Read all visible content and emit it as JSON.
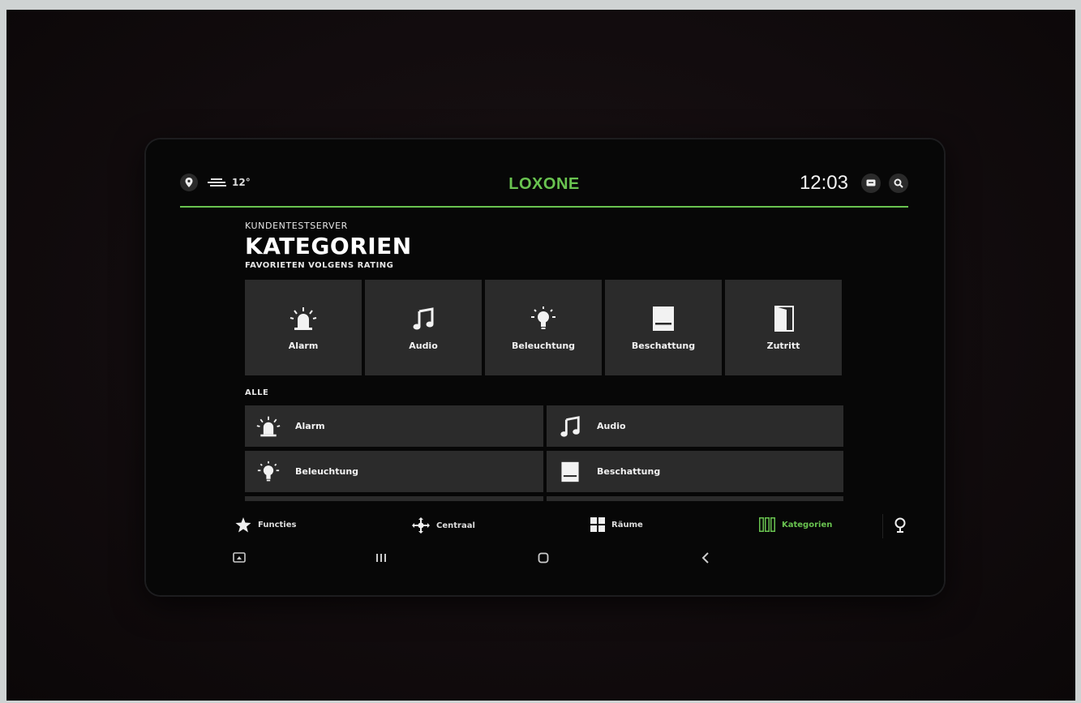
{
  "header": {
    "temperature": "12°",
    "brand": "LOXONE",
    "time": "12:03"
  },
  "page": {
    "server_name": "KUNDENTESTSERVER",
    "title": "KATEGORIEN",
    "favorites_label": "FAVORIETEN VOLGENS RATING",
    "all_label": "ALLE"
  },
  "favorites": [
    {
      "label": "Alarm",
      "icon": "siren-icon"
    },
    {
      "label": "Audio",
      "icon": "music-note-icon"
    },
    {
      "label": "Beleuchtung",
      "icon": "lightbulb-icon"
    },
    {
      "label": "Beschattung",
      "icon": "blind-icon"
    },
    {
      "label": "Zutritt",
      "icon": "door-icon"
    }
  ],
  "all_categories": [
    {
      "label": "Alarm",
      "icon": "siren-icon"
    },
    {
      "label": "Audio",
      "icon": "music-note-icon"
    },
    {
      "label": "Beleuchtung",
      "icon": "lightbulb-icon"
    },
    {
      "label": "Beschattung",
      "icon": "blind-icon"
    }
  ],
  "nav": {
    "items": [
      {
        "label": "Functies",
        "icon": "star-icon"
      },
      {
        "label": "Centraal",
        "icon": "move-icon"
      },
      {
        "label": "Räume",
        "icon": "grid-icon"
      },
      {
        "label": "Kategorien",
        "icon": "categories-icon"
      }
    ],
    "active": "Kategorien"
  },
  "colors": {
    "accent": "#69c350",
    "tile": "#2b2b2b",
    "background": "#070707"
  }
}
